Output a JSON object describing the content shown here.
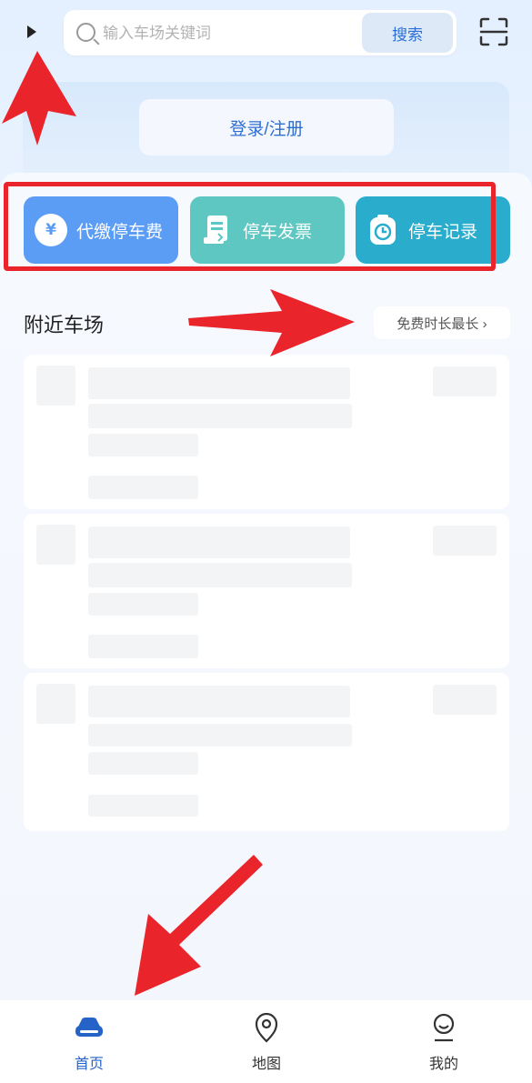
{
  "header": {
    "search_placeholder": "输入车场关键词",
    "search_button": "搜索"
  },
  "login": {
    "button": "登录/注册"
  },
  "quick_actions": [
    {
      "label": "代缴停车费",
      "icon": "yen-icon",
      "color": "#5b9cf5"
    },
    {
      "label": "停车发票",
      "icon": "invoice-icon",
      "color": "#5fc7c2"
    },
    {
      "label": "停车记录",
      "icon": "clock-icon",
      "color": "#2aaccd"
    }
  ],
  "nearby": {
    "title": "附近车场",
    "sort_label": "免费时长最长"
  },
  "tabs": [
    {
      "label": "首页",
      "icon": "car-icon",
      "active": true
    },
    {
      "label": "地图",
      "icon": "map-pin-icon",
      "active": false
    },
    {
      "label": "我的",
      "icon": "profile-icon",
      "active": false
    }
  ],
  "colors": {
    "accent": "#2563c9",
    "highlight": "#e9242a"
  }
}
